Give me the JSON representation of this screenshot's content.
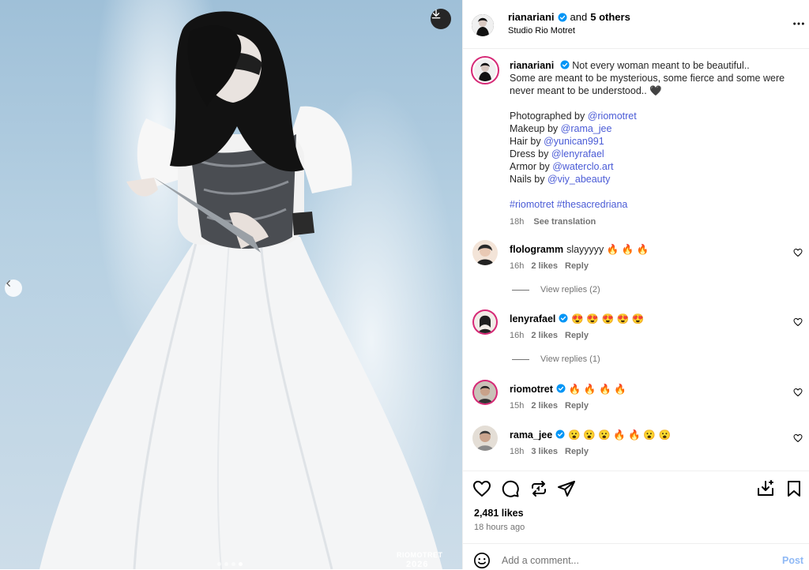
{
  "post": {
    "username": "rianariani",
    "coauthors": "and",
    "coauthors_count": "5 others",
    "location": "Studio Rio Motret",
    "watermark_line1": "RIOMOTRET",
    "watermark_line2": "2026",
    "carousel_active_index": 4,
    "carousel_count": 4
  },
  "caption": {
    "username": "rianariani",
    "line1": "Not every woman meant to be beautiful..",
    "line2": "Some are meant to be mysterious, some fierce and some were never meant to be understood.. 🖤",
    "credits": [
      {
        "label": "Photographed by",
        "handle": "@riomotret"
      },
      {
        "label": "Makeup by",
        "handle": "@rama_jee"
      },
      {
        "label": "Hair by",
        "handle": "@yunican991"
      },
      {
        "label": "Dress by",
        "handle": "@lenyrafael"
      },
      {
        "label": "Armor by",
        "handle": "@waterclo.art"
      },
      {
        "label": "Nails by",
        "handle": "@viy_abeauty"
      }
    ],
    "hashtags": "#riomotret #thesacredriana",
    "time": "18h",
    "translate": "See translation"
  },
  "comments": [
    {
      "username": "flologramm",
      "text": "slayyyyy 🔥 🔥 🔥",
      "time": "16h",
      "likes": "2 likes",
      "reply": "Reply",
      "view_replies": "View replies (2)",
      "verified": false
    },
    {
      "username": "lenyrafael",
      "text": "😍 😍 😍 😍 😍",
      "time": "16h",
      "likes": "2 likes",
      "reply": "Reply",
      "view_replies": "View replies (1)",
      "verified": true
    },
    {
      "username": "riomotret",
      "text": "🔥 🔥 🔥 🔥",
      "time": "15h",
      "likes": "2 likes",
      "reply": "Reply",
      "verified": true
    },
    {
      "username": "rama_jee",
      "text": "😮 😮 😮 🔥 🔥 😮 😮",
      "time": "18h",
      "likes": "3 likes",
      "reply": "Reply",
      "verified": true
    }
  ],
  "stats": {
    "likes": "2,481 likes",
    "time_ago": "18 hours ago"
  },
  "composer": {
    "placeholder": "Add a comment...",
    "post_label": "Post"
  },
  "colors": {
    "link": "#4a5bd6",
    "verified": "#0095f6",
    "muted": "#737373",
    "post_disabled": "#8fb9f5",
    "story_ring": "#d62976"
  },
  "icons": {
    "header": [
      "download-icon",
      "more-icon",
      "chevron-left-icon"
    ],
    "actions": [
      "heart-icon",
      "comment-icon",
      "repost-icon",
      "share-icon",
      "save-to-collection-icon",
      "bookmark-icon"
    ],
    "composer": [
      "emoji-icon"
    ]
  }
}
